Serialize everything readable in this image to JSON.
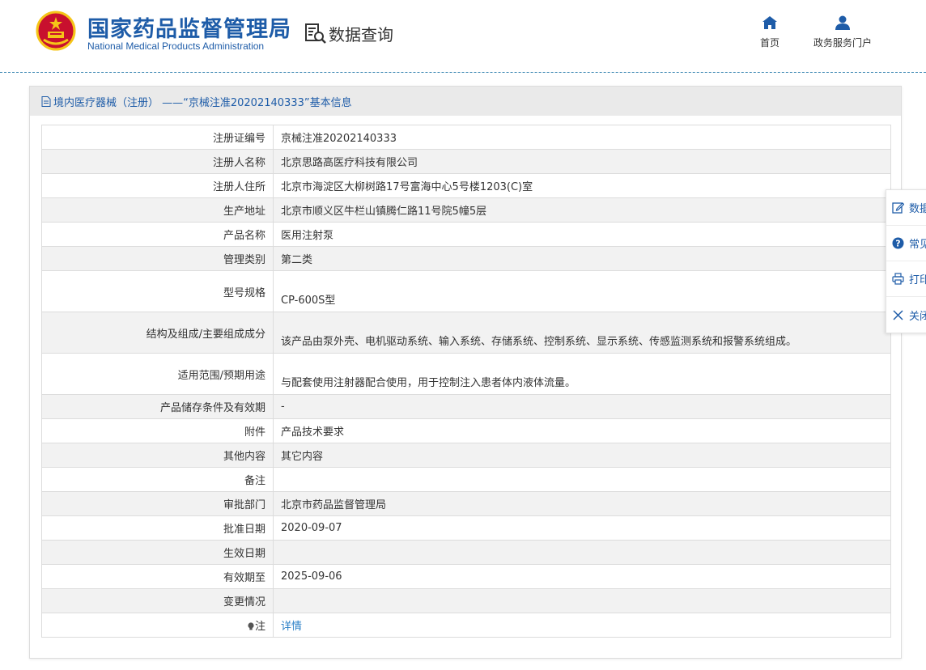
{
  "header": {
    "brand_cn": "国家药品监督管理局",
    "brand_en": "National Medical Products Administration",
    "query_label": "数据查询",
    "nav": {
      "home": "首页",
      "portal": "政务服务门户"
    }
  },
  "panel": {
    "title": "境内医疗器械（注册） ——“京械注准20202140333”基本信息"
  },
  "rows": [
    {
      "key": "注册证编号",
      "value": "京械注准20202140333"
    },
    {
      "key": "注册人名称",
      "value": "北京思路高医疗科技有限公司"
    },
    {
      "key": "注册人住所",
      "value": "北京市海淀区大柳树路17号富海中心5号楼1203(C)室"
    },
    {
      "key": "生产地址",
      "value": "北京市顺义区牛栏山镇腾仁路11号院5幢5层"
    },
    {
      "key": "产品名称",
      "value": "医用注射泵"
    },
    {
      "key": "管理类别",
      "value": "第二类"
    },
    {
      "key": "型号规格",
      "value": "CP-600S型"
    },
    {
      "key": "结构及组成/主要组成成分",
      "value": "该产品由泵外壳、电机驱动系统、输入系统、存储系统、控制系统、显示系统、传感监测系统和报警系统组成。"
    },
    {
      "key": "适用范围/预期用途",
      "value": "与配套使用注射器配合使用，用于控制注入患者体内液体流量。"
    },
    {
      "key": "产品储存条件及有效期",
      "value": "-"
    },
    {
      "key": "附件",
      "value": "产品技术要求"
    },
    {
      "key": "其他内容",
      "value": "其它内容"
    },
    {
      "key": "备注",
      "value": ""
    },
    {
      "key": "审批部门",
      "value": "北京市药品监督管理局"
    },
    {
      "key": "批准日期",
      "value": "2020-09-07"
    },
    {
      "key": "生效日期",
      "value": ""
    },
    {
      "key": "有效期至",
      "value": "2025-09-06"
    },
    {
      "key": "变更情况",
      "value": ""
    },
    {
      "key": "注",
      "value": "详情"
    }
  ],
  "float_bar": {
    "items": [
      {
        "label": "数据",
        "icon": "edit-icon"
      },
      {
        "label": "常见",
        "icon": "help-icon"
      },
      {
        "label": "打印",
        "icon": "print-icon"
      },
      {
        "label": "关闭",
        "icon": "close-icon"
      }
    ]
  },
  "colors": {
    "brand_blue": "#1e5ca8",
    "link_blue": "#2a7fc7",
    "row_alt": "#f2f2f2",
    "title_bar": "#eaeaea",
    "emblem_red": "#c8102e",
    "emblem_gold": "#f5c518"
  }
}
